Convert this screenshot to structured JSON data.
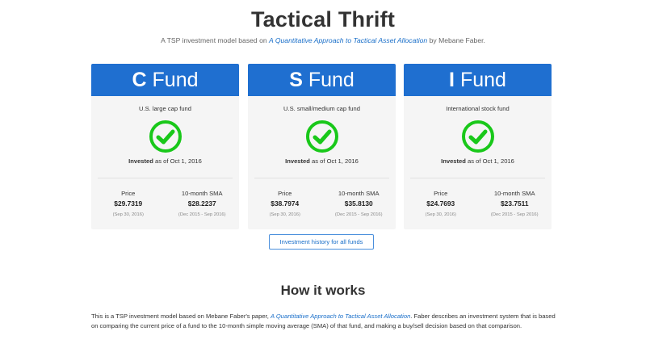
{
  "header": {
    "title": "Tactical Thrift",
    "subtitle_prefix": "A TSP investment model based on",
    "subtitle_link": "A Quantitative Approach to Tactical Asset Allocation",
    "subtitle_suffix": "by Mebane Faber."
  },
  "funds": [
    {
      "letter": "C",
      "word": "Fund",
      "description": "U.S. large cap fund",
      "status_icon": "check-circle-icon",
      "status_bold": "Invested",
      "status_rest": "as of Oct 1, 2016",
      "price_label": "Price",
      "price_value": "$29.7319",
      "price_date": "(Sep 30, 2016)",
      "sma_label": "10-month SMA",
      "sma_value": "$28.2237",
      "sma_date": "(Dec 2015 - Sep 2016)"
    },
    {
      "letter": "S",
      "word": "Fund",
      "description": "U.S. small/medium cap fund",
      "status_icon": "check-circle-icon",
      "status_bold": "Invested",
      "status_rest": "as of Oct 1, 2016",
      "price_label": "Price",
      "price_value": "$38.7974",
      "price_date": "(Sep 30, 2016)",
      "sma_label": "10-month SMA",
      "sma_value": "$35.8130",
      "sma_date": "(Dec 2015 - Sep 2016)"
    },
    {
      "letter": "I",
      "word": "Fund",
      "description": "International stock fund",
      "status_icon": "check-circle-icon",
      "status_bold": "Invested",
      "status_rest": "as of Oct 1, 2016",
      "price_label": "Price",
      "price_value": "$24.7693",
      "price_date": "(Sep 30, 2016)",
      "sma_label": "10-month SMA",
      "sma_value": "$23.7511",
      "sma_date": "(Dec 2015 - Sep 2016)"
    }
  ],
  "history_button": "Investment history for all funds",
  "how_it_works": {
    "title": "How it works",
    "text_prefix": "This is a TSP investment model based on Mebane Faber's paper,",
    "text_link": "A Quantitative Approach to Tactical Asset Allocation",
    "text_suffix": ". Faber describes an investment system that is based on comparing the current price of a fund to the 10-month simple moving average (SMA) of that fund, and making a buy/sell decision based on that comparison."
  },
  "colors": {
    "card_header": "#1f6fd0",
    "card_background": "#f5f5f5",
    "check_green": "#19c81a",
    "link": "#1a6fc9"
  }
}
